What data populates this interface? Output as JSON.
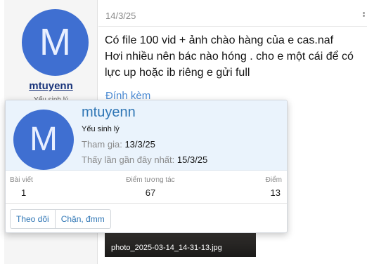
{
  "post": {
    "author": {
      "avatar_letter": "M",
      "username": "mtuyenn",
      "user_title": "Yếu sinh lý"
    },
    "date": "14/3/25",
    "body_lines": [
      "Có file 100 vid + ảnh chào hàng của e cas.naf",
      "Hơi nhiều nên bác nào hóng . cho e một cái để có",
      "lực up hoặc ib riêng e gửi full"
    ],
    "attachments_label": "Đính kèm",
    "attachment_filename": "photo_2025-03-14_14-31-13.jpg"
  },
  "member_tooltip": {
    "avatar_letter": "M",
    "username": "mtuyenn",
    "user_title": "Yếu sinh lý",
    "joined_label": "Tham gia:",
    "joined_value": "13/3/25",
    "last_seen_label": "Thấy lần gần đây nhất:",
    "last_seen_value": "15/3/25",
    "stats": {
      "posts_label": "Bài viết",
      "posts_value": "1",
      "reactions_label": "Điểm tương tác",
      "reactions_value": "67",
      "points_label": "Điểm",
      "points_value": "13"
    },
    "actions": {
      "follow_label": "Theo dõi",
      "ignore_label": "Chặn, đmm"
    }
  },
  "colors": {
    "avatar_bg": "#3f6fd1",
    "link_blue": "#2f76b5",
    "tooltip_header_bg": "#eaf3fc"
  }
}
